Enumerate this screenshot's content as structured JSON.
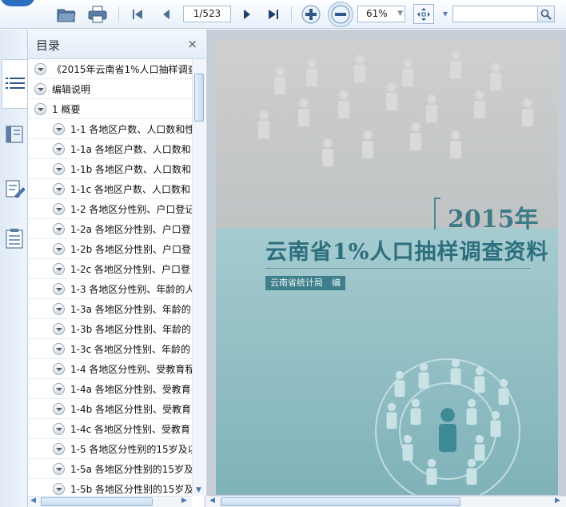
{
  "toolbar": {
    "page_indicator": "1/523",
    "zoom_value": "61%",
    "search_placeholder": ""
  },
  "sidebar": {
    "title": "目录",
    "close_glyph": "×",
    "items": [
      {
        "label": "《2015年云南省1%人口抽样调查",
        "level": 0
      },
      {
        "label": "编辑说明",
        "level": 0
      },
      {
        "label": "1 概要",
        "level": 0
      },
      {
        "label": "1-1 各地区户数、人口数和性",
        "level": 1
      },
      {
        "label": "1-1a 各地区户数、人口数和",
        "level": 1
      },
      {
        "label": "1-1b 各地区户数、人口数和",
        "level": 1
      },
      {
        "label": "1-1c 各地区户数、人口数和",
        "level": 1
      },
      {
        "label": "1-2 各地区分性别、户口登记",
        "level": 1
      },
      {
        "label": "1-2a 各地区分性别、户口登",
        "level": 1
      },
      {
        "label": "1-2b 各地区分性别、户口登",
        "level": 1
      },
      {
        "label": "1-2c 各地区分性别、户口登",
        "level": 1
      },
      {
        "label": "1-3 各地区分性别、年龄的人",
        "level": 1
      },
      {
        "label": "1-3a 各地区分性别、年龄的",
        "level": 1
      },
      {
        "label": "1-3b 各地区分性别、年龄的",
        "level": 1
      },
      {
        "label": "1-3c 各地区分性别、年龄的",
        "level": 1
      },
      {
        "label": "1-4 各地区分性别、受教育程",
        "level": 1
      },
      {
        "label": "1-4a 各地区分性别、受教育",
        "level": 1
      },
      {
        "label": "1-4b 各地区分性别、受教育",
        "level": 1
      },
      {
        "label": "1-4c 各地区分性别、受教育",
        "level": 1
      },
      {
        "label": "1-5 各地区分性别的15岁及以",
        "level": 1
      },
      {
        "label": "1-5a 各地区分性别的15岁及",
        "level": 1
      },
      {
        "label": "1-5b 各地区分性别的15岁及",
        "level": 1
      }
    ]
  },
  "cover": {
    "year": "2015年",
    "title": "云南省1%人口抽样调查资料",
    "publisher": "云南省统计局　编"
  },
  "colors": {
    "accent": "#2b6fbf",
    "cover_teal": "#2d6f7c",
    "toolbar_icon": "#4a6f99"
  }
}
